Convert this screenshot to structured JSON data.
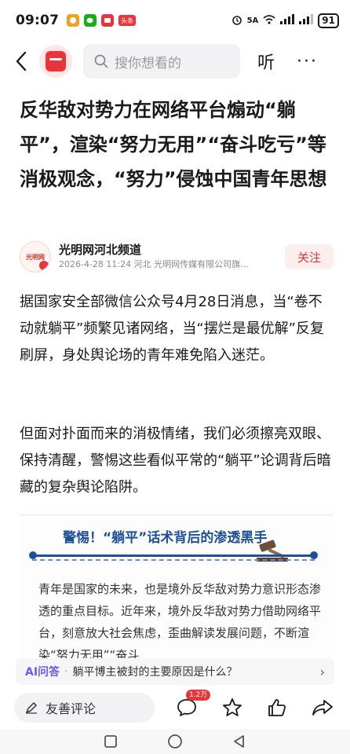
{
  "status_bar": {
    "time": "09:07",
    "news_app_label": "头条",
    "network": "5A",
    "battery": "91"
  },
  "nav": {
    "search_placeholder": "搜你想看的",
    "listen_label": "听",
    "more_label": "···"
  },
  "article": {
    "headline": "反华敌对势力在网络平台煽动“躺平”，渲染“努力无用”“奋斗吃亏”等消极观念，“努力”侵蚀中国青年思想",
    "source_name": "光明网河北频道",
    "source_meta": "2026-4-28  11:24  河北  光明网传媒有限公司旗...",
    "follow_label": "关注",
    "avatar_text": "光明网",
    "paragraphs": [
      "据国家安全部微信公众号4月28日消息，当“卷不动就躺平”频繁见诸网络，当“摆烂是最优解”反复刷屏，身处舆论场的青年难免陷入迷茫。",
      "但面对扑面而来的消极情绪，我们必须擦亮双眼、保持清醒，警惕这些看似平常的“躺平”论调背后暗藏的复杂舆论陷阱。"
    ]
  },
  "embed": {
    "title": "警惕！“躺平”话术背后的渗透黑手",
    "text": "青年是国家的未来，也是境外反华敌对势力意识形态渗透的重点目标。近年来，境外反华敌对势力借助网络平台，刻意放大社会焦虑，歪曲解读发展问题，不断渲染“努力无用”“奋斗"
  },
  "ai_bar": {
    "label": "AI问答",
    "separator": "·",
    "question": "躺平博主被封的主要原因是什么？",
    "arrow": "›"
  },
  "bottom_bar": {
    "comment_placeholder": "友善评论",
    "comment_count": "1.2万"
  },
  "colors": {
    "accent": "#e8343a",
    "embed_blue": "#1d4f9a",
    "ai_purple": "#6a5cf0"
  }
}
